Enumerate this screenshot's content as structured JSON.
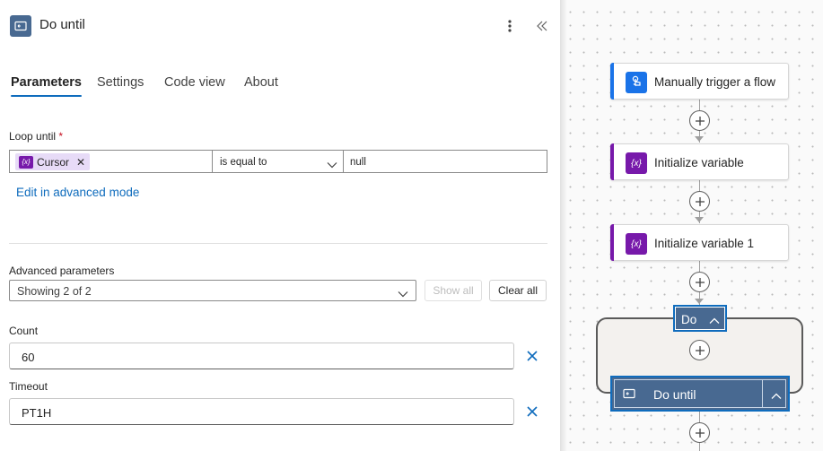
{
  "panel": {
    "title": "Do until",
    "tabs": [
      "Parameters",
      "Settings",
      "Code view",
      "About"
    ],
    "active_tab": "Parameters",
    "loop_until": {
      "label": "Loop until",
      "required_mark": "*",
      "token": "Cursor",
      "operator": "is equal to",
      "value": "null"
    },
    "edit_advanced_link": "Edit in advanced mode",
    "advanced": {
      "label": "Advanced parameters",
      "selected": "Showing 2 of 2",
      "show_all": "Show all",
      "clear_all": "Clear all"
    },
    "count": {
      "label": "Count",
      "value": "60"
    },
    "timeout": {
      "label": "Timeout",
      "value": "PT1H"
    }
  },
  "canvas": {
    "nodes": [
      {
        "label": "Manually trigger a flow",
        "icon": "touch-icon",
        "color": "#1a73e8"
      },
      {
        "label": "Initialize variable",
        "icon": "variable-icon",
        "color": "#7719aa"
      },
      {
        "label": "Initialize variable 1",
        "icon": "variable-icon",
        "color": "#7719aa"
      }
    ],
    "scope_badge": "Do",
    "selected_node": "Do until"
  },
  "colors": {
    "accent": "#0f6cbd",
    "loop_node": "#486991",
    "variable": "#7719aa",
    "trigger": "#1a73e8"
  }
}
